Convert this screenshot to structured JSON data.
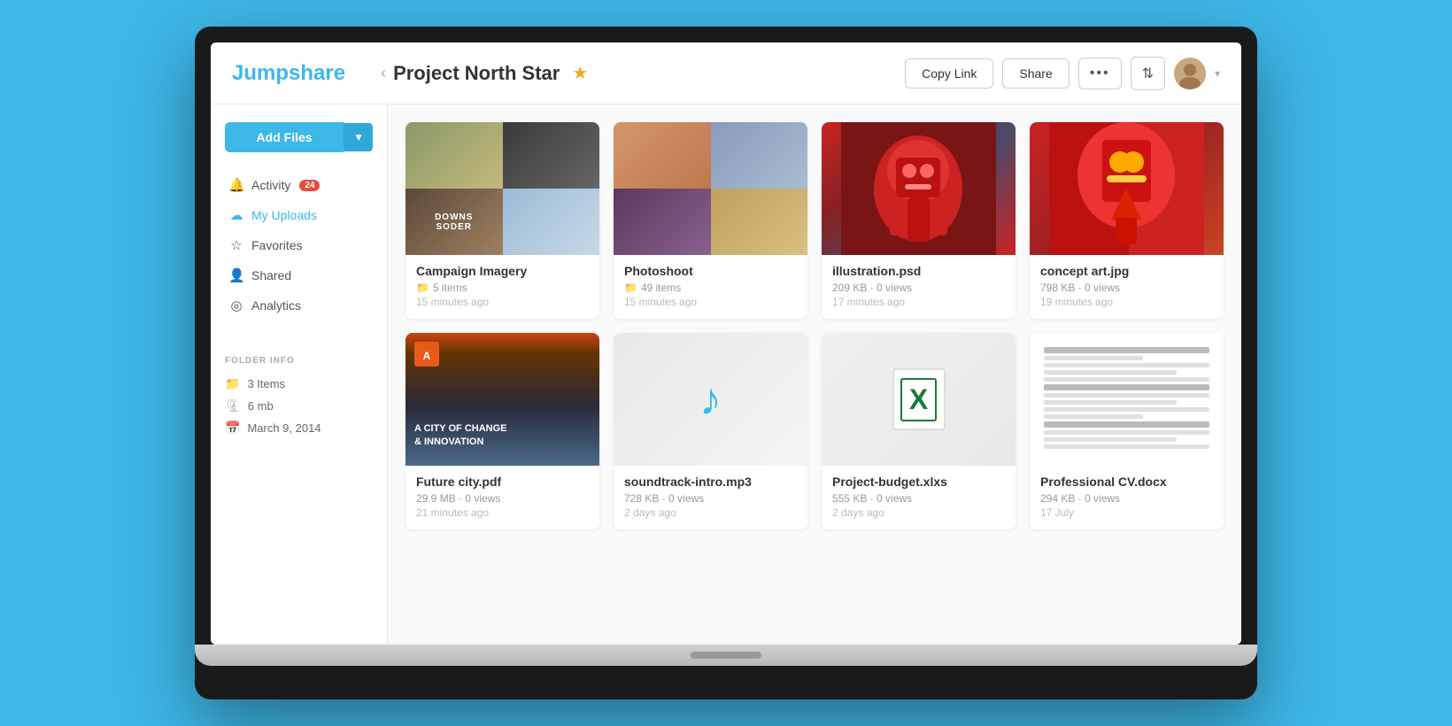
{
  "app": {
    "logo": "Jumpshare"
  },
  "header": {
    "back_chevron": "‹",
    "project_title": "Project North Star",
    "star_icon": "★",
    "copy_link_label": "Copy Link",
    "share_label": "Share",
    "more_label": "•••",
    "sort_icon": "⇅"
  },
  "sidebar": {
    "add_files_label": "Add Files",
    "add_files_arrow": "▼",
    "nav_items": [
      {
        "id": "activity",
        "icon": "🔔",
        "label": "Activity",
        "badge": "24"
      },
      {
        "id": "my-uploads",
        "icon": "☁",
        "label": "My Uploads",
        "badge": ""
      },
      {
        "id": "favorites",
        "icon": "☆",
        "label": "Favorites",
        "badge": ""
      },
      {
        "id": "shared",
        "icon": "👤",
        "label": "Shared",
        "badge": ""
      },
      {
        "id": "analytics",
        "icon": "◎",
        "label": "Analytics",
        "badge": ""
      }
    ],
    "folder_info_title": "FOLDER INFO",
    "folder_items": [
      {
        "icon": "📁",
        "label": "3 Items"
      },
      {
        "icon": "🗜",
        "label": "6 mb"
      },
      {
        "icon": "📅",
        "label": "March 9, 2014"
      }
    ]
  },
  "files": [
    {
      "id": "campaign-imagery",
      "name": "Campaign Imagery",
      "type": "folder",
      "meta": "5 items",
      "time": "15 minutes ago",
      "thumb_type": "campaign"
    },
    {
      "id": "photoshoot",
      "name": "Photoshoot",
      "type": "folder",
      "meta": "49 items",
      "time": "15 minutes ago",
      "thumb_type": "photoshoot"
    },
    {
      "id": "illustration-psd",
      "name": "illustration.psd",
      "type": "file",
      "meta": "209 KB · 0 views",
      "time": "17 minutes ago",
      "thumb_type": "illustration"
    },
    {
      "id": "concept-art",
      "name": "concept art.jpg",
      "type": "file",
      "meta": "798 KB · 0 views",
      "time": "19 minutes ago",
      "thumb_type": "concept"
    },
    {
      "id": "future-city",
      "name": "Future city.pdf",
      "type": "file",
      "meta": "29.9 MB · 0 views",
      "time": "21 minutes ago",
      "thumb_type": "pdf"
    },
    {
      "id": "soundtrack",
      "name": "soundtrack-intro.mp3",
      "type": "file",
      "meta": "728 KB · 0 views",
      "time": "2 days ago",
      "thumb_type": "music"
    },
    {
      "id": "project-budget",
      "name": "Project-budget.xlxs",
      "type": "file",
      "meta": "555 KB · 0 views",
      "time": "2 days ago",
      "thumb_type": "excel"
    },
    {
      "id": "professional-cv",
      "name": "Professional CV.docx",
      "type": "file",
      "meta": "294 KB · 0 views",
      "time": "17 July",
      "thumb_type": "cv"
    }
  ]
}
